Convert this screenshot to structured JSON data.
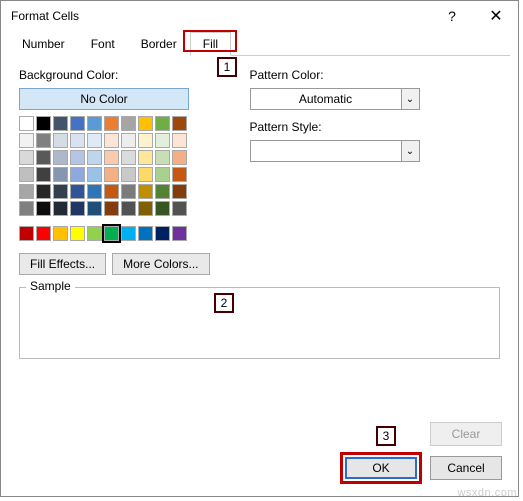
{
  "title": "Format Cells",
  "help_glyph": "?",
  "close_glyph": "✕",
  "tabs": [
    "Number",
    "Font",
    "Border",
    "Fill"
  ],
  "active_tab": 3,
  "left": {
    "bg_label": "Background Color:",
    "no_color": "No Color",
    "theme_rows": [
      [
        "#ffffff",
        "#000000",
        "#44546a",
        "#4472c4",
        "#5b9bd5",
        "#ed7d31",
        "#a5a5a5",
        "#ffc000",
        "#70ad47",
        "#9e480e"
      ],
      [
        "#f2f2f2",
        "#808080",
        "#d6dce4",
        "#d9e1f2",
        "#deebf6",
        "#fce4d6",
        "#ededed",
        "#fff2cc",
        "#e2efda",
        "#fbe5d6"
      ],
      [
        "#d9d9d9",
        "#595959",
        "#adb9ca",
        "#b4c6e7",
        "#bdd6ee",
        "#f8cbad",
        "#dbdbdb",
        "#ffe699",
        "#c6e0b4",
        "#f4b084"
      ],
      [
        "#bfbfbf",
        "#404040",
        "#8496b0",
        "#8ea9db",
        "#9bc2e6",
        "#f4b084",
        "#c9c9c9",
        "#ffd966",
        "#a9d08e",
        "#c65911"
      ],
      [
        "#a6a6a6",
        "#262626",
        "#333f4f",
        "#305496",
        "#2f75b5",
        "#c65911",
        "#7b7b7b",
        "#bf8f00",
        "#548235",
        "#833c0c"
      ],
      [
        "#808080",
        "#0d0d0d",
        "#222b35",
        "#203764",
        "#1f4e78",
        "#833c0c",
        "#525252",
        "#806000",
        "#375623",
        "#525252"
      ]
    ],
    "standard_row": [
      "#c00000",
      "#ff0000",
      "#ffc000",
      "#ffff00",
      "#92d050",
      "#00b050",
      "#00b0f0",
      "#0070c0",
      "#002060",
      "#7030a0"
    ],
    "selected_standard_index": 5,
    "fill_effects": "Fill Effects...",
    "more_colors": "More Colors..."
  },
  "right": {
    "pattern_color_label": "Pattern Color:",
    "pattern_color_value": "Automatic",
    "pattern_style_label": "Pattern Style:",
    "chevron": "⌄"
  },
  "sample_label": "Sample",
  "footer": {
    "clear": "Clear",
    "ok": "OK",
    "cancel": "Cancel"
  },
  "callouts": {
    "one": "1",
    "two": "2",
    "three": "3"
  },
  "watermark": "wsxdn.com"
}
